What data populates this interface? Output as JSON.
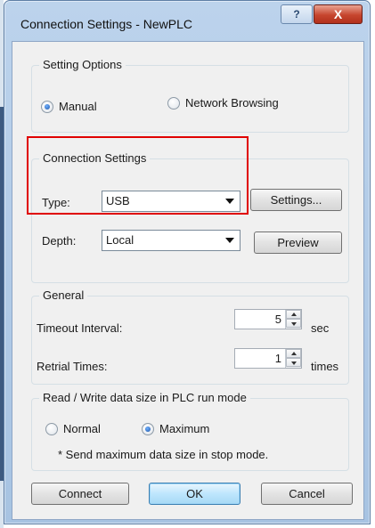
{
  "window": {
    "title": "Connection Settings - NewPLC",
    "help_label": "?",
    "close_label": "X"
  },
  "setting_options": {
    "legend": "Setting Options",
    "manual": "Manual",
    "network_browsing": "Network Browsing",
    "selected": "Manual"
  },
  "connection_settings": {
    "legend": "Connection Settings",
    "type_label": "Type:",
    "type_value": "USB",
    "depth_label": "Depth:",
    "depth_value": "Local",
    "settings_button": "Settings...",
    "preview_button": "Preview"
  },
  "general": {
    "legend": "General",
    "timeout_label": "Timeout Interval:",
    "timeout_value": "5",
    "timeout_unit": "sec",
    "retrial_label": "Retrial Times:",
    "retrial_value": "1",
    "retrial_unit": "times"
  },
  "read_write": {
    "legend": "Read / Write data size in PLC run mode",
    "normal": "Normal",
    "maximum": "Maximum",
    "selected": "Maximum",
    "note": "* Send maximum data size in stop mode."
  },
  "buttons": {
    "connect": "Connect",
    "ok": "OK",
    "cancel": "Cancel"
  },
  "colors": {
    "highlight_box": "#e00000",
    "close_button": "#c6452e",
    "title_bar": "#bcd3ec"
  }
}
